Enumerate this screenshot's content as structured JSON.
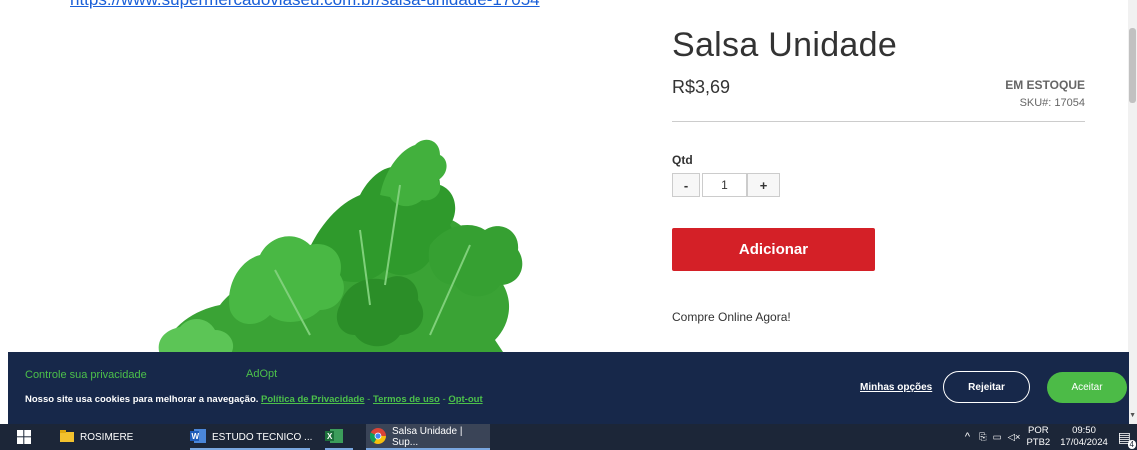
{
  "top_link": {
    "text": "https://www.supermercadoviaseu.com.br/salsa-unidade-17054"
  },
  "product": {
    "title": "Salsa Unidade",
    "price": "R$3,69",
    "stock": "EM ESTOQUE",
    "sku": "SKU#:  17054",
    "qty_label": "Qtd",
    "qty_value": "1",
    "minus_label": "-",
    "plus_label": "+",
    "add_button": "Adicionar",
    "compre_text": "Compre Online Agora!"
  },
  "cookie": {
    "title": "Controle sua privacidade",
    "brand": "AdOpt",
    "text": "Nosso site usa cookies para melhorar a navegação.",
    "link_privacy": "Política de Privacidade",
    "link_terms": "Termos de uso",
    "link_optout": "Opt-out",
    "separator": " - ",
    "options": "Minhas opções",
    "reject": "Rejeitar",
    "accept": "Aceitar"
  },
  "taskbar": {
    "folder_label": "ROSIMERE",
    "word_label": "ESTUDO TECNICO ...",
    "chrome_label": "Salsa Unidade | Sup...",
    "lang_top": "POR",
    "lang_bottom": "PTB2",
    "time": "09:50",
    "date": "17/04/2024",
    "notif_count": "4"
  },
  "colors": {
    "accent_red": "#d42027",
    "banner_bg": "#17284a",
    "green": "#4cbb47",
    "link_blue": "#1a5fd8"
  }
}
